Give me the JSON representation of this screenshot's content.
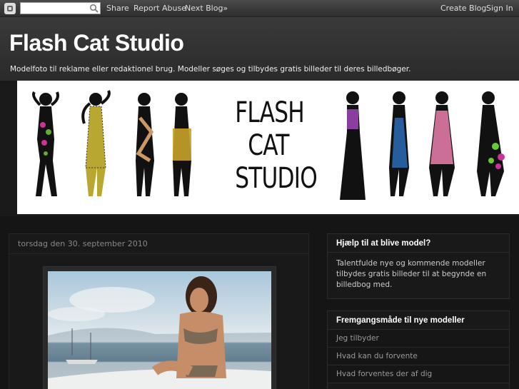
{
  "navbar": {
    "share": "Share",
    "report_abuse": "Report Abuse",
    "next_blog": "Next Blog»",
    "create_blog": "Create Blog",
    "sign_in": "Sign In"
  },
  "header": {
    "title": "Flash Cat Studio",
    "description": "Modelfoto til reklame eller redaktionel brug. Modeller søges og tilbydes gratis billeder til deres billedbøger."
  },
  "banner": {
    "line1": "FLASH",
    "line2": "CAT",
    "line3": "STUDIO"
  },
  "post": {
    "date": "torsdag den 30. september 2010"
  },
  "widgets": {
    "help": {
      "title": "Hjælp til at blive model?",
      "body": "Talentfulde nye og kommende modeller tilbydes gratis billeder til at begynde en billedbog med."
    },
    "procedure": {
      "title": "Fremgangsmåde til nye modeller",
      "items": [
        "Jeg tilbyder",
        "Hvad kan du forvente",
        "Hvad forventes der af dig"
      ]
    }
  },
  "colors": {
    "background": "#111111",
    "navbar": "#3a3a3a",
    "title": "#ffffff"
  }
}
